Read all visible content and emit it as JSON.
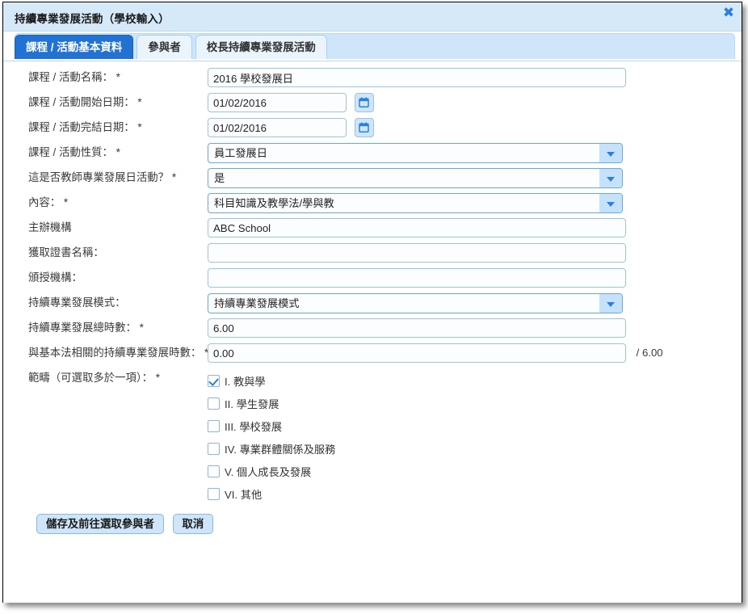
{
  "window": {
    "title": "持續專業發展活動（學校輸入）",
    "close_label": "✖"
  },
  "tabs": [
    {
      "label": "課程 / 活動基本資料",
      "active": true
    },
    {
      "label": "參與者",
      "active": false
    },
    {
      "label": "校長持續專業發展活動",
      "active": false
    }
  ],
  "form": {
    "course_name": {
      "label": "課程 / 活動名稱：",
      "required": "*",
      "value": "2016 學校發展日"
    },
    "start_date": {
      "label": "課程 / 活動開始日期：",
      "required": "*",
      "value": "01/02/2016",
      "picker_icon": "calendar-icon"
    },
    "end_date": {
      "label": "課程 / 活動完結日期：",
      "required": "*",
      "value": "01/02/2016",
      "picker_icon": "calendar-icon"
    },
    "nature": {
      "label": "課程 / 活動性質：",
      "required": "*",
      "value": "員工發展日"
    },
    "is_pd_day": {
      "label": "這是否教師專業發展日活動？",
      "required": "*",
      "value": "是"
    },
    "content": {
      "label": "內容：",
      "required": "*",
      "value": "科目知識及教學法/學與教"
    },
    "organiser": {
      "label": "主辦機構",
      "required": "",
      "value": "ABC School"
    },
    "certificate": {
      "label": "獲取證書名稱：",
      "required": "",
      "value": ""
    },
    "awarding_body": {
      "label": "頒授機構：",
      "required": "",
      "value": ""
    },
    "cpd_mode": {
      "label": "持續專業發展模式：",
      "required": "",
      "value": "持續專業發展模式"
    },
    "total_hours": {
      "label": "持續專業發展總時數：",
      "required": "*",
      "value": "6.00"
    },
    "bl_hours": {
      "label": "與基本法相關的持續專業發展時數：",
      "required": "*",
      "value": "0.00",
      "suffix": "/ 6.00"
    },
    "domains": {
      "label": "範疇（可選取多於一項）：",
      "required": "*",
      "items": [
        {
          "label": "I. 教與學",
          "checked": true
        },
        {
          "label": "II. 學生發展",
          "checked": false
        },
        {
          "label": "III. 學校發展",
          "checked": false
        },
        {
          "label": "IV. 專業群體關係及服務",
          "checked": false
        },
        {
          "label": "V. 個人成長及發展",
          "checked": false
        },
        {
          "label": "VI. 其他",
          "checked": false
        }
      ]
    }
  },
  "footer": {
    "save_label": "儲存及前往選取參與者",
    "cancel_label": "取消"
  },
  "colors": {
    "accent": "#2272d4",
    "titlebar": "#d6e9f8",
    "tabstrip": "#cfe6fa",
    "field_border": "#9cc4e4"
  }
}
